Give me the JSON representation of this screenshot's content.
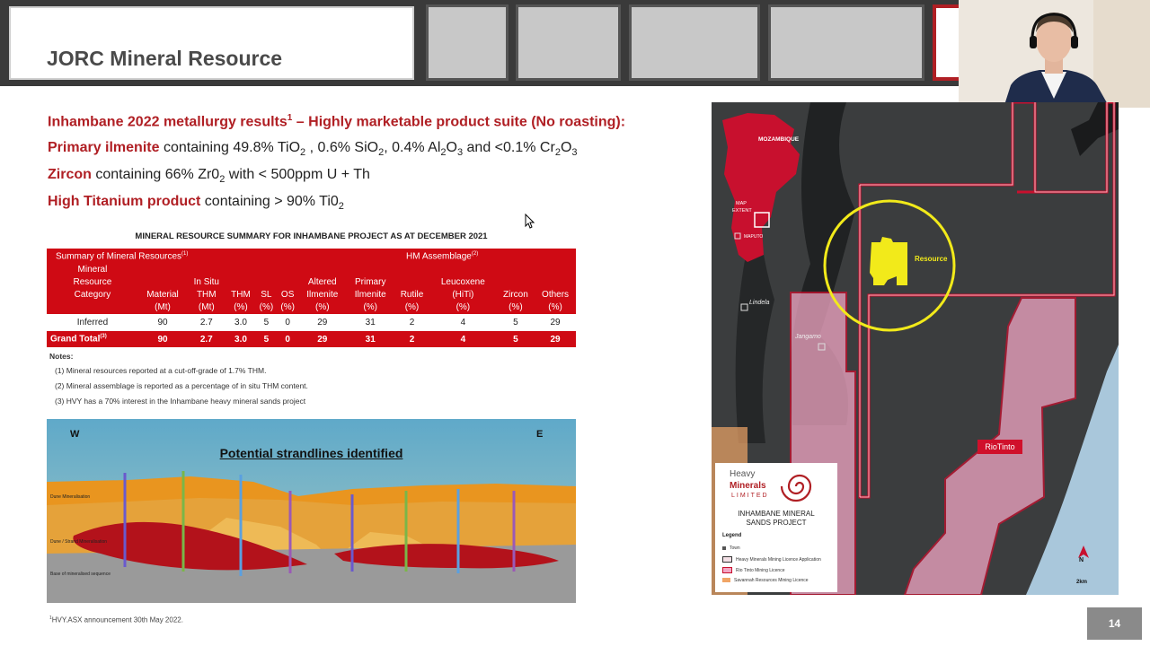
{
  "header": {
    "title": "JORC Mineral Resource"
  },
  "intro": {
    "line1_bold": "Inhambane 2022 metallurgy results",
    "line1_sup": "1",
    "line1_rest": " – Highly marketable product suite (No roasting):",
    "line2_bold": "Primary ilmenite",
    "line2_a": " containing 49.8% TiO",
    "line2_sub1": "2",
    "line2_b": " , 0.6% SiO",
    "line2_sub2": "2",
    "line2_c": ", 0.4% Al",
    "line2_sub3": "2",
    "line2_d": "O",
    "line2_sub4": "3",
    "line2_e": " and <0.1% Cr",
    "line2_sub5": "2",
    "line2_f": "O",
    "line2_sub6": "3",
    "line3_bold": "Zircon",
    "line3_a": " containing 66% Zr0",
    "line3_sub": "2",
    "line3_b": " with < 500ppm U + Th",
    "line4_bold": "High Titanium product",
    "line4_a": " containing > 90% Ti0",
    "line4_sub": "2"
  },
  "table": {
    "title": "MINERAL RESOURCE SUMMARY FOR INHAMBANE PROJECT AS AT DECEMBER 2021",
    "summary_label": "Summary of Mineral Resources",
    "summary_sup": "(1)",
    "hm_label": "HM Assemblage",
    "hm_sup": "(2)",
    "columns": [
      {
        "l1": "Mineral",
        "l2": "Resource",
        "l3": "Category",
        "l4": ""
      },
      {
        "l1": "",
        "l2": "",
        "l3": "Material",
        "l4": "(Mt)"
      },
      {
        "l1": "",
        "l2": "In Situ",
        "l3": "THM",
        "l4": "(Mt)"
      },
      {
        "l1": "",
        "l2": "",
        "l3": "THM",
        "l4": "(%)"
      },
      {
        "l1": "",
        "l2": "",
        "l3": "SL",
        "l4": "(%)"
      },
      {
        "l1": "",
        "l2": "",
        "l3": "OS",
        "l4": "(%)"
      },
      {
        "l1": "",
        "l2": "Altered",
        "l3": "Ilmenite",
        "l4": "(%)"
      },
      {
        "l1": "",
        "l2": "Primary",
        "l3": "Ilmenite",
        "l4": "(%)"
      },
      {
        "l1": "",
        "l2": "",
        "l3": "Rutile",
        "l4": "(%)"
      },
      {
        "l1": "",
        "l2": "Leucoxene",
        "l3": "(HiTi)",
        "l4": "(%)"
      },
      {
        "l1": "",
        "l2": "",
        "l3": "Zircon",
        "l4": "(%)"
      },
      {
        "l1": "",
        "l2": "",
        "l3": "Others",
        "l4": "(%)"
      }
    ],
    "rows": [
      {
        "cells": [
          "Inferred",
          "90",
          "2.7",
          "3.0",
          "5",
          "0",
          "29",
          "31",
          "2",
          "4",
          "5",
          "29"
        ]
      }
    ],
    "total": {
      "label": "Grand Total",
      "sup": "(3)",
      "cells": [
        "90",
        "2.7",
        "3.0",
        "5",
        "0",
        "29",
        "31",
        "2",
        "4",
        "5",
        "29"
      ]
    },
    "notes_title": "Notes:",
    "notes": [
      "(1) Mineral resources reported at a cut-off-grade of 1.7% THM.",
      "(2) Mineral assemblage is reported as a percentage of in situ THM content.",
      "(3) HVY has a 70% interest in the Inhambane heavy mineral sands project"
    ]
  },
  "section": {
    "title": "Potential strandlines identified",
    "west": "W",
    "east": "E",
    "label_dune": "Dune Mineralisation",
    "label_strand": "Dune / Strand Mineralisation",
    "label_base": "Base of mineralised sequence"
  },
  "map": {
    "mozambique": "MOZAMBIQUE",
    "map_extent_1": "MAP",
    "map_extent_2": "EXTENT",
    "maputo": "MAPUTO",
    "resource": "Resource",
    "lindela": "Lindela",
    "jangamo": "Jangamo",
    "riotinto": "RioTinto",
    "north": "N",
    "scale": "2km",
    "legend": {
      "brand1": "Heavy",
      "brand2": "Minerals",
      "brand3": "LIMITED",
      "project1": "INHAMBANE MINERAL",
      "project2": "SANDS PROJECT",
      "legend_title": "Legend",
      "items": [
        {
          "label": "Town",
          "color": "#555555"
        },
        {
          "label": "Heavy Minerals Mining Licence Application",
          "color": "#f4e0e6"
        },
        {
          "label": "Rio Tinto Mining Licence",
          "color": "#f2a6c4"
        },
        {
          "label": "Savannah Resources Mining Licence",
          "color": "#f0a566"
        }
      ]
    }
  },
  "footer": {
    "footnote_sup": "1",
    "footnote": "HVY.ASX announcement 30th May 2022.",
    "page": "14"
  },
  "colors": {
    "accent_red": "#b01f24",
    "table_red": "#cf0a14",
    "resource_yellow": "#f2ea1a"
  }
}
